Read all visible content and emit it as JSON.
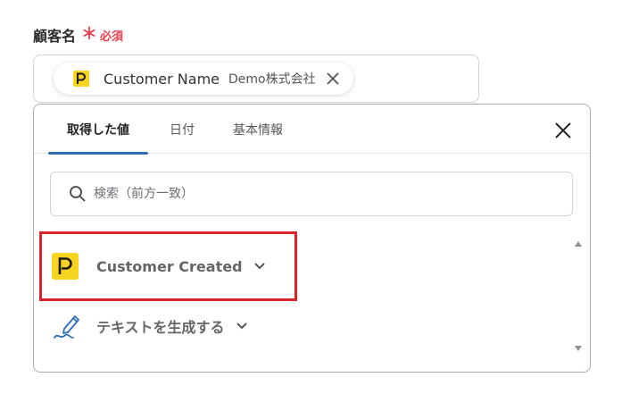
{
  "field": {
    "label": "顧客名",
    "required_star": "＊",
    "required_text": "必須",
    "chip": {
      "name": "Customer Name",
      "value": "Demo株式会社"
    }
  },
  "panel": {
    "tabs": [
      {
        "label": "取得した値",
        "active": true
      },
      {
        "label": "日付",
        "active": false
      },
      {
        "label": "基本情報",
        "active": false
      }
    ],
    "search": {
      "placeholder": "検索（前方一致）",
      "value": ""
    },
    "items": [
      {
        "label": "Customer Created",
        "icon": "p-app-icon"
      },
      {
        "label": "テキストを生成する",
        "icon": "pen-icon"
      }
    ]
  },
  "colors": {
    "required": "#e8424f",
    "tab_underline": "#2e6eb8",
    "highlight": "#d8242b",
    "app_badge": "#f6d41f"
  }
}
